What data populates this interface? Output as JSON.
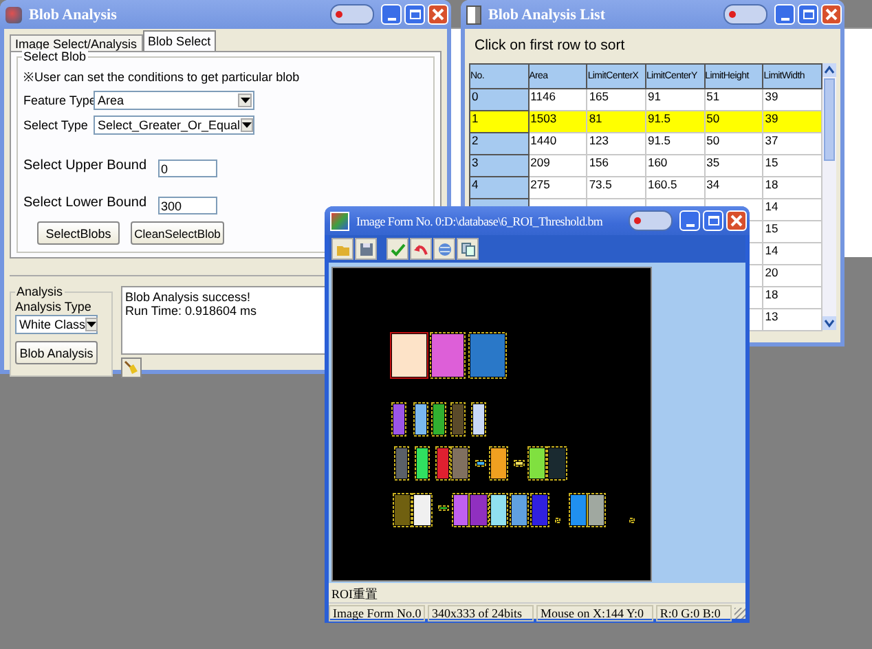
{
  "blob_analysis_window": {
    "title": "Blob Analysis",
    "tabs": [
      {
        "label": "Image Select/Analysis",
        "selected": false
      },
      {
        "label": "Blob Select",
        "selected": true
      }
    ],
    "select_blob": {
      "legend": "Select Blob",
      "note": "※User can set the conditions to get particular blob",
      "feature_type": {
        "label": "Feature Type",
        "value": "Area"
      },
      "select_type": {
        "label": "Select Type",
        "value": "Select_Greater_Or_Equal"
      },
      "upper_bound": {
        "label": "Select Upper Bound",
        "value": "0"
      },
      "lower_bound": {
        "label": "Select Lower Bound",
        "value": "300"
      },
      "buttons": [
        "SelectBlobs",
        "CleanSelectBlob"
      ]
    },
    "analysis": {
      "legend": "Analysis",
      "type_label": "Analysis Type",
      "type_value": "White Class",
      "button": "Blob Analysis"
    },
    "log": [
      "Blob Analysis success!",
      "Run Time: 0.918604 ms"
    ]
  },
  "blob_list_window": {
    "title": "Blob Analysis List",
    "hint": "Click on first row to sort",
    "table": {
      "columns": [
        "No.",
        "Area",
        "LimitCenterX",
        "LimitCenterY",
        "LimitHeight",
        "LimitWidth"
      ],
      "rows": [
        {
          "selected": false,
          "cells": [
            "0",
            "1146",
            "165",
            "91",
            "51",
            "39"
          ]
        },
        {
          "selected": true,
          "cells": [
            "1",
            "1503",
            "81",
            "91.5",
            "50",
            "39"
          ]
        },
        {
          "selected": false,
          "cells": [
            "2",
            "1440",
            "123",
            "91.5",
            "50",
            "37"
          ]
        },
        {
          "selected": false,
          "cells": [
            "3",
            "209",
            "156",
            "160",
            "35",
            "15"
          ]
        },
        {
          "selected": false,
          "cells": [
            "4",
            "275",
            "73.5",
            "160.5",
            "34",
            "18"
          ]
        },
        {
          "selected": false,
          "cells": [
            null,
            null,
            null,
            null,
            null,
            "14"
          ]
        },
        {
          "selected": false,
          "cells": [
            null,
            null,
            null,
            null,
            null,
            "15"
          ]
        },
        {
          "selected": false,
          "cells": [
            null,
            null,
            null,
            null,
            null,
            "14"
          ]
        },
        {
          "selected": false,
          "cells": [
            null,
            null,
            null,
            null,
            null,
            "20"
          ]
        },
        {
          "selected": false,
          "cells": [
            null,
            null,
            null,
            null,
            null,
            "18"
          ]
        },
        {
          "selected": false,
          "cells": [
            null,
            null,
            null,
            null,
            null,
            "13"
          ]
        }
      ]
    }
  },
  "image_form_window": {
    "title": "Image Form No. 0:D:\\database\\6_ROI_Threshold.bm",
    "status_text": "ROI重置",
    "status_bar": [
      "Image Form No.0",
      "340x333 of 24bits",
      "Mouse on X:144 Y:0",
      "R:0 G:0 B:0"
    ]
  }
}
